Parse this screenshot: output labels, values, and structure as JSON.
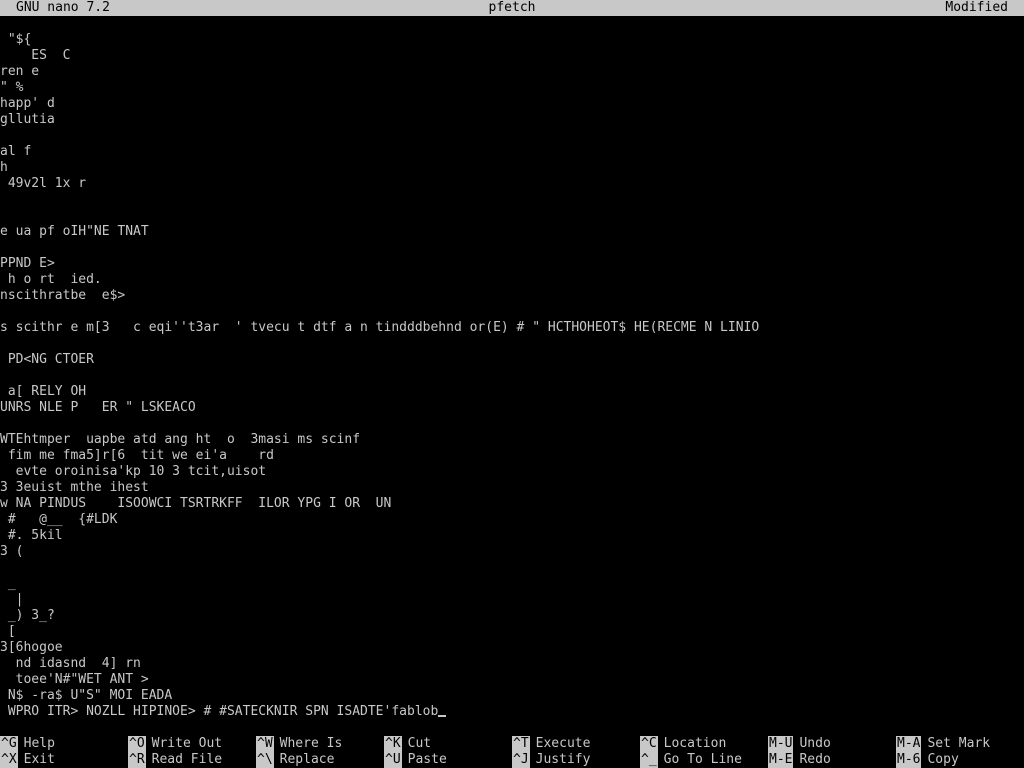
{
  "titlebar": {
    "left": "GNU nano 7.2",
    "center": "pfetch",
    "right": "Modified"
  },
  "editor": {
    "lines": [
      " \"${",
      "    ES  C",
      "ren e",
      "\" %",
      "happ' d",
      "gllutia",
      "",
      "al f",
      "h",
      " 49v2l 1x r",
      "",
      "",
      "e ua pf oIH\"NE TNAT",
      "",
      "PPND E>",
      " h o rt  ied.",
      "nscithratbe  e$>",
      "",
      "s scithr e m[3   c eqi''t3ar  ' tvecu t dtf a n tindddbehnd or(E) # \" HCTHOHEOT$ HE(RECME N LINIO",
      "",
      " PD<NG CTOER",
      "",
      " a[ RELY OH",
      "UNRS NLE P   ER \" LSKEACO",
      "",
      "WTEhtmper  uapbe atd ang ht  o  3masi ms scinf",
      " fim me fma5]r[6  tit we ei'a    rd",
      "  evte oroinisa'kp 10 3 tcit,uisot",
      "3 3euist mthe ihest",
      "w NA PINDUS    ISOOWCI TSRTRKFF  ILOR YPG I OR  UN",
      " #   @__  {#LDK",
      " #. 5kil",
      "3 (",
      "",
      " _",
      "  |",
      " _) 3_?",
      " [",
      "3[6hogoe",
      "  nd idasnd  4] rn",
      "  toee'N#\"WET ANT >",
      " N$ -ra$ U\"S\" MOI EADA",
      " WPRO ITR> NOZLL HIPINOE> # #SATECKNIR SPN ISADTE'fablob"
    ]
  },
  "shortcuts": [
    {
      "key": "^G",
      "label": "Help"
    },
    {
      "key": "^X",
      "label": "Exit"
    },
    {
      "key": "^O",
      "label": "Write Out"
    },
    {
      "key": "^R",
      "label": "Read File"
    },
    {
      "key": "^W",
      "label": "Where Is"
    },
    {
      "key": "^\\",
      "label": "Replace"
    },
    {
      "key": "^K",
      "label": "Cut"
    },
    {
      "key": "^U",
      "label": "Paste"
    },
    {
      "key": "^T",
      "label": "Execute"
    },
    {
      "key": "^J",
      "label": "Justify"
    },
    {
      "key": "^C",
      "label": "Location"
    },
    {
      "key": "^_",
      "label": "Go To Line"
    },
    {
      "key": "M-U",
      "label": "Undo"
    },
    {
      "key": "M-E",
      "label": "Redo"
    },
    {
      "key": "M-A",
      "label": "Set Mark"
    },
    {
      "key": "M-6",
      "label": "Copy"
    }
  ],
  "colors": {
    "background": "#000000",
    "foreground": "#c8c8c8",
    "inverse_text": "#000000"
  }
}
